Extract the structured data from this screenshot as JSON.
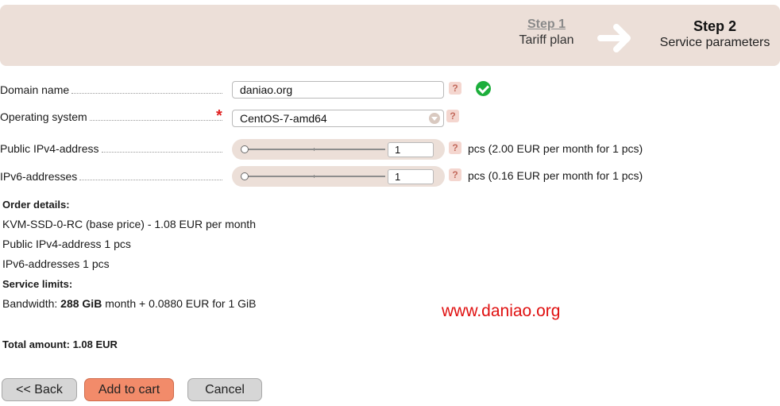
{
  "steps": {
    "step1": {
      "title": "Step 1",
      "subtitle": "Tariff plan"
    },
    "step2": {
      "title": "Step 2",
      "subtitle": "Service parameters"
    },
    "arrow_icon": "arrow-right-icon"
  },
  "form": {
    "domain": {
      "label": "Domain name",
      "value": "daniao.org",
      "help": "?"
    },
    "os": {
      "label": "Operating system",
      "required_mark": "*",
      "value": "CentOS-7-amd64",
      "help": "?"
    },
    "ipv4": {
      "label": "Public IPv4-address",
      "value": "1",
      "help": "?",
      "price_text": "pcs (2.00 EUR per month for 1 pcs)"
    },
    "ipv6": {
      "label": "IPv6-addresses",
      "value": "1",
      "help": "?",
      "price_text": "pcs (0.16 EUR per month for 1 pcs)"
    }
  },
  "order": {
    "heading": "Order details:",
    "line1": "KVM-SSD-0-RC (base price) - 1.08 EUR per month",
    "line2": "Public IPv4-address 1 pcs",
    "line3": "IPv6-addresses 1 pcs",
    "limits_heading": "Service limits:",
    "bandwidth_prefix": "Bandwidth: ",
    "bandwidth_value": "288 GiB",
    "bandwidth_suffix": " month + 0.0880 EUR for 1 GiB",
    "total": "Total amount: 1.08 EUR"
  },
  "watermark": "www.daniao.org",
  "buttons": {
    "back": "<< Back",
    "add_to_cart": "Add to cart",
    "cancel": "Cancel"
  },
  "colors": {
    "accent": "#f28b6a",
    "header_bg": "#ecdfd8",
    "success": "#1cae3b",
    "required": "#e02020"
  }
}
